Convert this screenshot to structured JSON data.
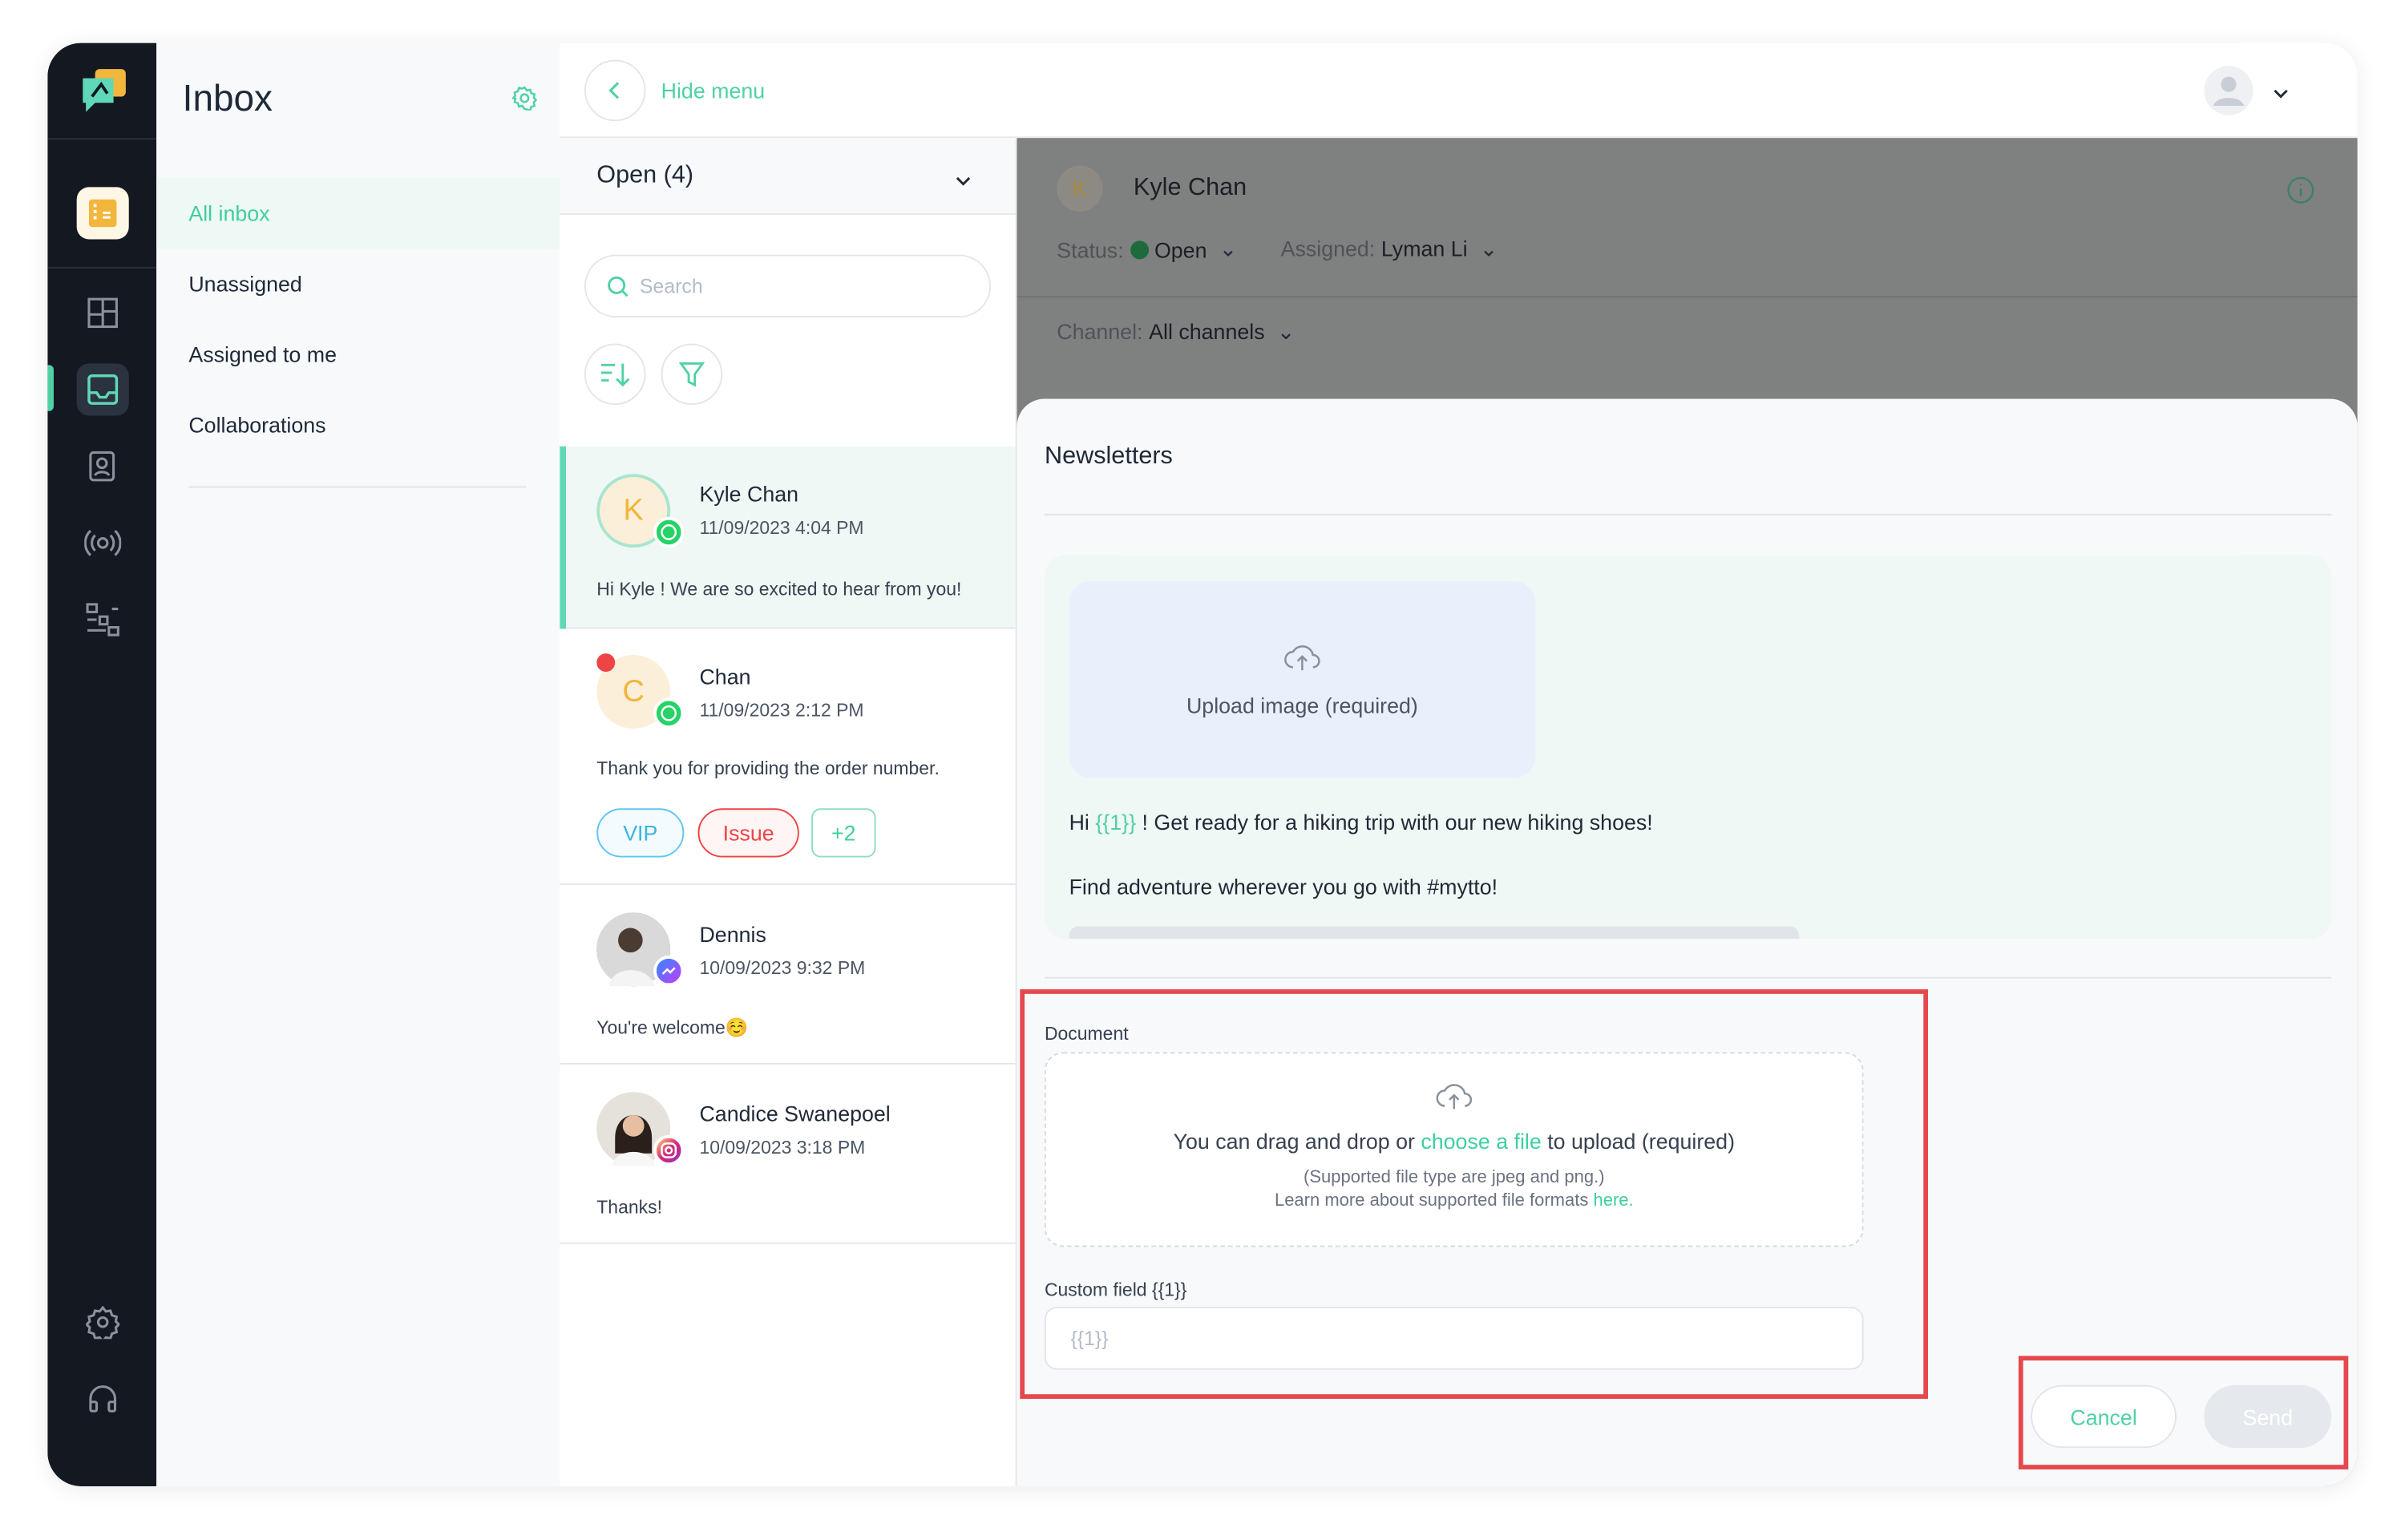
{
  "nav": {
    "icons": [
      "building-icon",
      "dashboard-icon",
      "inbox-icon",
      "contacts-icon",
      "broadcast-icon",
      "workflow-icon",
      "settings-icon",
      "headset-icon"
    ],
    "active": "inbox-icon"
  },
  "sidebar": {
    "title": "Inbox",
    "items": [
      {
        "label": "All inbox",
        "active": true
      },
      {
        "label": "Unassigned"
      },
      {
        "label": "Assigned to me"
      },
      {
        "label": "Collaborations"
      }
    ]
  },
  "topbar": {
    "hide_menu": "Hide menu"
  },
  "list": {
    "filter": "Open (4)",
    "search_placeholder": "Search",
    "items": [
      {
        "name": "Kyle Chan",
        "initial": "K",
        "date": "11/09/2023 4:04 PM",
        "message": "Hi Kyle ! We are so excited to hear from you!",
        "channel": "whatsapp",
        "selected": true
      },
      {
        "name": "Chan",
        "initial": "C",
        "date": "11/09/2023 2:12 PM",
        "message": "Thank you for providing the order number.",
        "channel": "whatsapp",
        "unread": true,
        "tags": [
          "VIP",
          "Issue",
          "+2"
        ]
      },
      {
        "name": "Dennis",
        "date": "10/09/2023 9:32 PM",
        "message": "You're welcome☺️",
        "channel": "messenger"
      },
      {
        "name": "Candice Swanepoel",
        "date": "10/09/2023 3:18 PM",
        "message": "Thanks!",
        "channel": "instagram"
      }
    ]
  },
  "conversation": {
    "initial": "K",
    "name": "Kyle Chan",
    "status_label": "Status:",
    "status": "Open",
    "assigned_label": "Assigned:",
    "assigned": "Lyman Li",
    "channel_label": "Channel:",
    "channel": "All channels"
  },
  "modal": {
    "title": "Newsletters",
    "upload_image": "Upload image (required)",
    "preview_hi": "Hi",
    "preview_var": "{{1}}",
    "preview_line1": "! Get ready for a hiking trip with our new hiking shoes!",
    "preview_line2": "Find adventure wherever you go with #mytto!",
    "document_label": "Document",
    "drop_pre": "You can drag and drop or",
    "drop_link": "choose a file",
    "drop_post": "to upload (required)",
    "supported": "(Supported file type are jpeg and png.)",
    "learn_pre": "Learn more about supported file formats",
    "learn_link": "here.",
    "custom_label": "Custom field {{1}}",
    "custom_placeholder": "{{1}}",
    "cancel": "Cancel",
    "send": "Send"
  },
  "colors": {
    "accent": "#4fd1a5",
    "nav_bg": "#141821",
    "highlight": "#e5484d"
  }
}
